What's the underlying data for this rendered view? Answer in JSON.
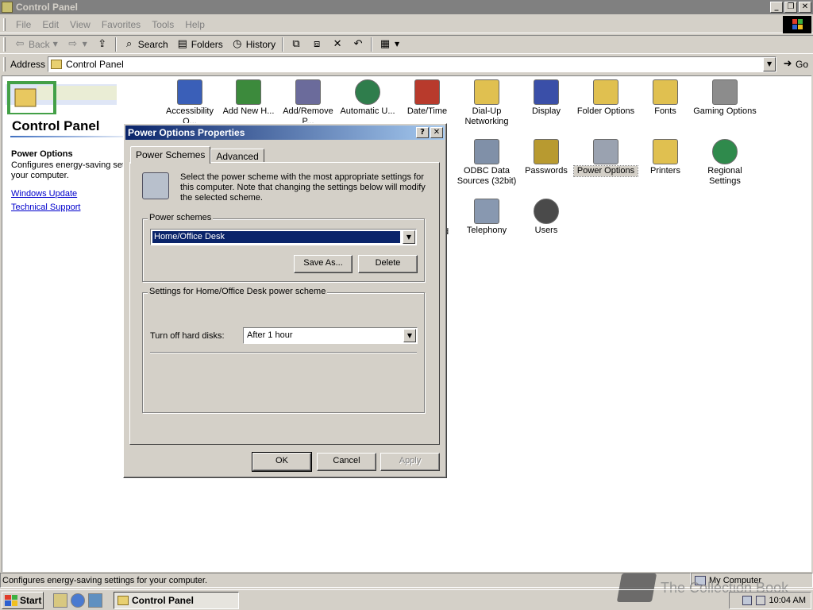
{
  "window": {
    "title": "Control Panel"
  },
  "menu": [
    "File",
    "Edit",
    "View",
    "Favorites",
    "Tools",
    "Help"
  ],
  "toolbar": {
    "back": "Back",
    "search": "Search",
    "folders": "Folders",
    "history": "History"
  },
  "address": {
    "label": "Address",
    "value": "Control Panel",
    "go": "Go"
  },
  "left_panel": {
    "title": "Control Panel",
    "selected_name": "Power Options",
    "selected_desc": "Configures energy-saving set your computer.",
    "links": [
      "Windows Update",
      "Technical Support"
    ]
  },
  "icons": [
    {
      "label": "Accessibility O...",
      "color": "#3a5fb8"
    },
    {
      "label": "Add New H...",
      "color": "#3c8a3c"
    },
    {
      "label": "Add/Remove P...",
      "color": "#6b6b9b"
    },
    {
      "label": "Automatic U...",
      "color": "#2f7d4c"
    },
    {
      "label": "Date/Time",
      "color": "#b83a2c"
    },
    {
      "label": "Dial-Up Networking",
      "color": "#e0c050"
    },
    {
      "label": "Display",
      "color": "#3a4fa8"
    },
    {
      "label": "Folder Options",
      "color": "#e0c050"
    },
    {
      "label": "Fonts",
      "color": "#e0c050"
    },
    {
      "label": "Gaming Options",
      "color": "#8c8c8c"
    },
    {
      "label": "ODBC Data Sources (32bit)",
      "color": "#8090a8"
    },
    {
      "label": "Passwords",
      "color": "#b89a30"
    },
    {
      "label": "Power Options",
      "color": "#9aa2b0"
    },
    {
      "label": "Printers",
      "color": "#e0c050"
    },
    {
      "label": "Regional Settings",
      "color": "#2f8a4c"
    },
    {
      "label": "d",
      "color": "#ffffff"
    },
    {
      "label": "Telephony",
      "color": "#8898b0"
    },
    {
      "label": "Users",
      "color": "#4a4a4a"
    }
  ],
  "status": {
    "left": "Configures energy-saving settings for your computer.",
    "right": "My Computer"
  },
  "taskbar": {
    "start": "Start",
    "task": "Control Panel",
    "clock": "10:04 AM"
  },
  "watermark": "The Collection Book",
  "dialog": {
    "title": "Power Options Properties",
    "tabs": [
      "Power Schemes",
      "Advanced"
    ],
    "intro": "Select the power scheme with the most appropriate settings for this computer. Note that changing the settings below will modify the selected scheme.",
    "schemes_label": "Power schemes",
    "scheme_value": "Home/Office Desk",
    "save_as": "Save As...",
    "delete": "Delete",
    "settings_label": "Settings for Home/Office Desk power scheme",
    "harddisk_label": "Turn off hard disks:",
    "harddisk_value": "After 1 hour",
    "ok": "OK",
    "cancel": "Cancel",
    "apply": "Apply"
  }
}
